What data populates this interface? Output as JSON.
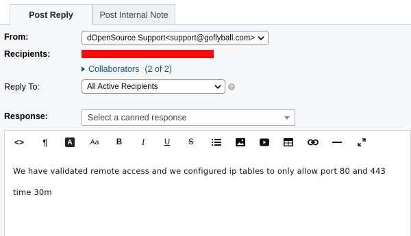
{
  "tabs": [
    {
      "label": "Post Reply",
      "active": true
    },
    {
      "label": "Post Internal Note",
      "active": false
    }
  ],
  "form": {
    "from_label": "From:",
    "from_value": "dOpenSource Support<support@goflyball.com>",
    "recipients_label": "Recipients:",
    "collaborators_link": "Collaborators",
    "collaborators_count": "(2 of 2)",
    "reply_to_label": "Reply To:",
    "reply_to_value": "All Active Recipients",
    "response_label": "Response:",
    "canned_placeholder": "Select a canned response"
  },
  "toolbar": {
    "code_glyph": "<>",
    "paragraph_glyph": "¶",
    "text_color_glyph": "A",
    "font_size_glyph": "Aa",
    "bold_glyph": "B",
    "italic_glyph": "I",
    "underline_glyph": "U",
    "strike_glyph": "S"
  },
  "editor": {
    "paragraphs": [
      "We have validated remote access and we configured ip tables to only allow port 80 and 443",
      "time 30m"
    ]
  },
  "colors": {
    "link": "#184e81",
    "redaction": "#ff0a0a",
    "panel_bg": "#f5f7f9",
    "border": "#c9d3dc"
  }
}
